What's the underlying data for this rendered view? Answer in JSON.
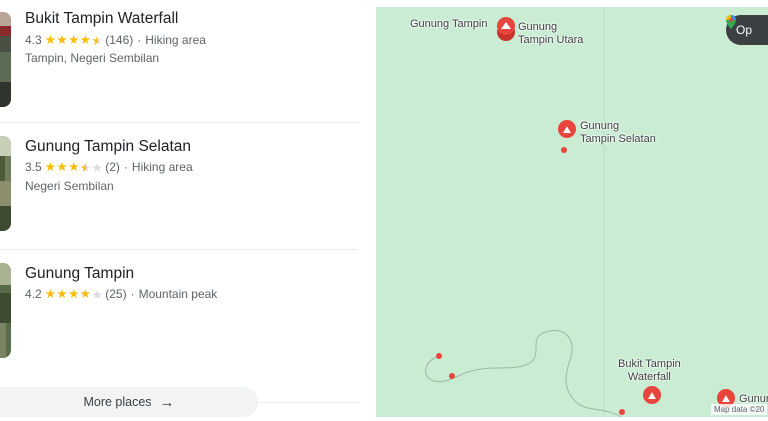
{
  "places": [
    {
      "name": "Bukit Tampin Waterfall",
      "rating": "4.3",
      "rating_value": 4.3,
      "reviews": "(146)",
      "category": "Hiking area",
      "address": "Tampin, Negeri Sembilan"
    },
    {
      "name": "Gunung Tampin Selatan",
      "rating": "3.5",
      "rating_value": 3.5,
      "reviews": "(2)",
      "category": "Hiking area",
      "address": "Negeri Sembilan"
    },
    {
      "name": "Gunung Tampin",
      "rating": "4.2",
      "rating_value": 4.2,
      "reviews": "(25)",
      "category": "Mountain peak",
      "address": ""
    }
  ],
  "more_places_label": "More places",
  "map": {
    "open_button_label": "Op",
    "attribution": "Map data ©20",
    "labels": {
      "gunung_tampin": "Gunung Tampin",
      "gunung_tampin_utara_1": "Gunung",
      "gunung_tampin_utara_2": "Tampin Utara",
      "gunung_tampin_selatan_1": "Gunung",
      "gunung_tampin_selatan_2": "Tampin Selatan",
      "bukit_tampin_waterfall_1": "Bukit Tampin",
      "bukit_tampin_waterfall_2": "Waterfall",
      "gunung_cut": "Gunur"
    }
  },
  "colors": {
    "map_background": "#c9ecd2",
    "pin_red": "#e8453c",
    "star_gold": "#fbbc04",
    "star_grey": "#dadce0"
  }
}
